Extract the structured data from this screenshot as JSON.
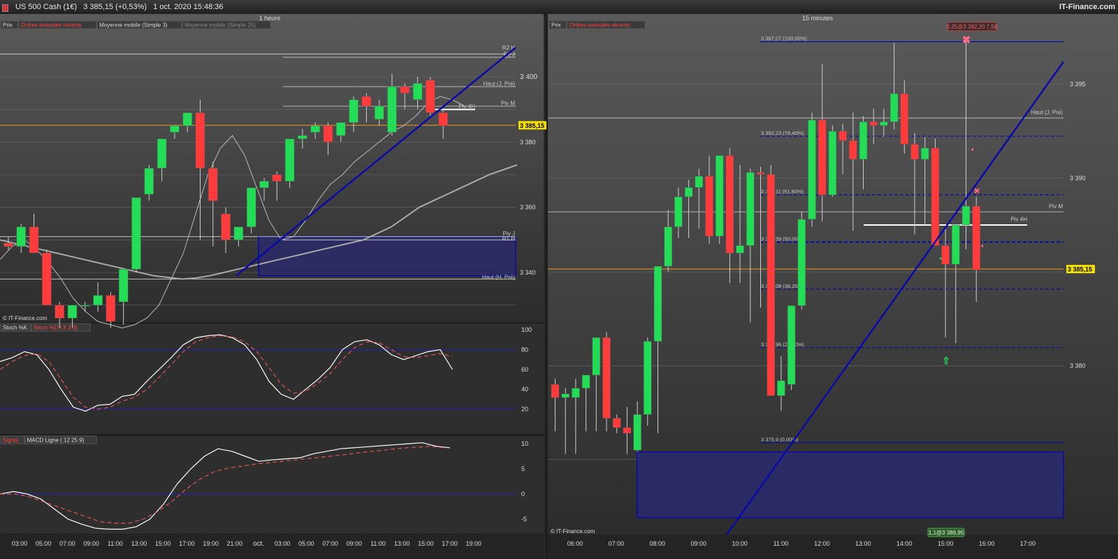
{
  "header": {
    "instrument": "US 500 Cash (1€)",
    "last_quote": "3 385,15 (+0,53%)",
    "datetime": "1 oct. 2020 15:48:36",
    "brand": "IT-Finance.com"
  },
  "colors": {
    "bull": "#22dd55",
    "bear": "#ff3b3b",
    "trend": "#0a0aa8",
    "last_price": "#e8a020",
    "zone": "#2a2a6a"
  },
  "left_chart": {
    "timeframe": "1 heure",
    "tabs": [
      "Prix",
      "Ordres exécutés récents",
      "Moyenne mobile (Simple 3)",
      "Moyenne mobile (Simple 25)"
    ],
    "price_ticks": [
      "3 400",
      "3 380",
      "3 360",
      "3 340"
    ],
    "last_price_label": "3 385,15",
    "levels": [
      "R2 H",
      "R1 J",
      "Haut (J, Pré)",
      "Piv M",
      "Piv 4H",
      "Piv J",
      "R1 H",
      "Haut (H, Pré)"
    ],
    "watermark": "© IT-Finance.com",
    "stoch": {
      "tabs": [
        "Stoch %K",
        "Stoch %D ( 8 3 3)"
      ],
      "ticks": [
        "100",
        "80",
        "60",
        "40",
        "20"
      ]
    },
    "macd": {
      "tabs": [
        "Signal",
        "MACD Ligne ( 12 25 9)"
      ],
      "ticks": [
        "10",
        "5",
        "0",
        "-5"
      ]
    },
    "time_labels": [
      "03:00",
      "05:00",
      "07:00",
      "09:00",
      "11:00",
      "13:00",
      "15:00",
      "17:00",
      "19:00",
      "21:00",
      "oct.",
      "03:00",
      "05:00",
      "07:00",
      "09:00",
      "11:00",
      "13:00",
      "15:00",
      "17:00",
      "19:00"
    ]
  },
  "right_chart": {
    "timeframe": "15 minutes",
    "tabs": [
      "Prix",
      "Ordres exécutés récents"
    ],
    "price_ticks": [
      "3 395",
      "3 390",
      "3 380"
    ],
    "last_price_label": "3 385,15",
    "order_top": "0,25@3 392,20 7,58",
    "order_bottom": "1,1@3 386,95",
    "fib_levels": [
      "3 397,27 (100,00%)",
      "3 392,23 (76,40%)",
      "3 389,11 (61,80%)",
      "3 386,59 (50,00%)",
      "3 384,08 (38,20%)",
      "3 380,96 (23,60%)",
      "3 375,9 (0,00%)"
    ],
    "levels": [
      "Haut (J, Pré)",
      "Piv M",
      "Piv 4H"
    ],
    "watermark": "© IT-Finance.com",
    "time_labels": [
      "06:00",
      "07:00",
      "08:00",
      "09:00",
      "10:00",
      "11:00",
      "12:00",
      "13:00",
      "14:00",
      "15:00",
      "16:00",
      "17:00"
    ]
  },
  "chart_data": [
    {
      "type": "candlestick",
      "title": "US 500 Cash (1€) — 1 heure",
      "ylim": [
        3325,
        3415
      ],
      "candles": [
        {
          "o": 3349,
          "h": 3351,
          "l": 3347,
          "c": 3348
        },
        {
          "o": 3348,
          "h": 3355,
          "l": 3346,
          "c": 3354
        },
        {
          "o": 3354,
          "h": 3358,
          "l": 3347,
          "c": 3346
        },
        {
          "o": 3346,
          "h": 3347,
          "l": 3330,
          "c": 3330
        },
        {
          "o": 3330,
          "h": 3331,
          "l": 3323,
          "c": 3326
        },
        {
          "o": 3326,
          "h": 3330,
          "l": 3323,
          "c": 3330
        },
        {
          "o": 3330,
          "h": 3331,
          "l": 3328,
          "c": 3330
        },
        {
          "o": 3330,
          "h": 3337,
          "l": 3328,
          "c": 3333
        },
        {
          "o": 3333,
          "h": 3334,
          "l": 3323,
          "c": 3325
        },
        {
          "o": 3331,
          "h": 3341,
          "l": 3324,
          "c": 3341
        },
        {
          "o": 3341,
          "h": 3363,
          "l": 3340,
          "c": 3363
        },
        {
          "o": 3364,
          "h": 3373,
          "l": 3362,
          "c": 3372
        },
        {
          "o": 3372,
          "h": 3380,
          "l": 3368,
          "c": 3381
        },
        {
          "o": 3383,
          "h": 3385,
          "l": 3381,
          "c": 3385
        },
        {
          "o": 3385,
          "h": 3389,
          "l": 3383,
          "c": 3389
        },
        {
          "o": 3389,
          "h": 3393,
          "l": 3350,
          "c": 3372
        },
        {
          "o": 3372,
          "h": 3374,
          "l": 3348,
          "c": 3362
        },
        {
          "o": 3358,
          "h": 3360,
          "l": 3346,
          "c": 3350
        },
        {
          "o": 3350,
          "h": 3352,
          "l": 3348,
          "c": 3354
        },
        {
          "o": 3354,
          "h": 3358,
          "l": 3352,
          "c": 3366
        },
        {
          "o": 3366,
          "h": 3369,
          "l": 3362,
          "c": 3368
        },
        {
          "o": 3370,
          "h": 3371,
          "l": 3362,
          "c": 3368
        },
        {
          "o": 3368,
          "h": 3381,
          "l": 3366,
          "c": 3381
        },
        {
          "o": 3381,
          "h": 3384,
          "l": 3378,
          "c": 3382
        },
        {
          "o": 3383,
          "h": 3386,
          "l": 3381,
          "c": 3385
        },
        {
          "o": 3385,
          "h": 3386,
          "l": 3376,
          "c": 3380
        },
        {
          "o": 3382,
          "h": 3386,
          "l": 3380,
          "c": 3386
        },
        {
          "o": 3386,
          "h": 3394,
          "l": 3383,
          "c": 3393
        },
        {
          "o": 3394,
          "h": 3395,
          "l": 3386,
          "c": 3391
        },
        {
          "o": 3387,
          "h": 3393,
          "l": 3385,
          "c": 3391
        },
        {
          "o": 3383,
          "h": 3401,
          "l": 3382,
          "c": 3397
        },
        {
          "o": 3397,
          "h": 3398,
          "l": 3390,
          "c": 3395
        },
        {
          "o": 3393,
          "h": 3400,
          "l": 3390,
          "c": 3398
        },
        {
          "o": 3399,
          "h": 3400,
          "l": 3388,
          "c": 3389
        },
        {
          "o": 3389,
          "h": 3390,
          "l": 3381,
          "c": 3385
        }
      ]
    },
    {
      "type": "candlestick",
      "title": "US 500 Cash (1€) — 15 minutes",
      "ylim": [
        3371,
        3398
      ],
      "candles": [
        {
          "o": 3379,
          "h": 3379.3,
          "l": 3376.5,
          "c": 3378.3
        },
        {
          "o": 3378.3,
          "h": 3378.8,
          "l": 3375.3,
          "c": 3378.5
        },
        {
          "o": 3378.3,
          "h": 3379.3,
          "l": 3375.3,
          "c": 3378.8
        },
        {
          "o": 3378.8,
          "h": 3379.5,
          "l": 3376.5,
          "c": 3379.5
        },
        {
          "o": 3379.5,
          "h": 3381.3,
          "l": 3376.5,
          "c": 3381.5
        },
        {
          "o": 3381.5,
          "h": 3381.8,
          "l": 3376.5,
          "c": 3377.2
        },
        {
          "o": 3377.2,
          "h": 3377.4,
          "l": 3376.4,
          "c": 3376.7
        },
        {
          "o": 3376.7,
          "h": 3377.8,
          "l": 3375.3,
          "c": 3376.4
        },
        {
          "o": 3375.5,
          "h": 3378.1,
          "l": 3374.3,
          "c": 3377.4
        },
        {
          "o": 3377.4,
          "h": 3381.5,
          "l": 3376.8,
          "c": 3381.3
        },
        {
          "o": 3381.3,
          "h": 3385.2,
          "l": 3376.4,
          "c": 3385.3
        },
        {
          "o": 3385.3,
          "h": 3388.3,
          "l": 3385.0,
          "c": 3387.4
        },
        {
          "o": 3387.4,
          "h": 3389.5,
          "l": 3386.8,
          "c": 3389.0
        },
        {
          "o": 3389.0,
          "h": 3389.9,
          "l": 3386.8,
          "c": 3389.5
        },
        {
          "o": 3389.5,
          "h": 3390.5,
          "l": 3387.3,
          "c": 3390.1
        },
        {
          "o": 3390.1,
          "h": 3391.2,
          "l": 3386.5,
          "c": 3386.9
        },
        {
          "o": 3386.9,
          "h": 3391.2,
          "l": 3386.5,
          "c": 3391.2
        },
        {
          "o": 3391.2,
          "h": 3391.6,
          "l": 3384.4,
          "c": 3386.0
        },
        {
          "o": 3386.0,
          "h": 3390.7,
          "l": 3384.4,
          "c": 3386.4
        },
        {
          "o": 3386.4,
          "h": 3390.5,
          "l": 3382.3,
          "c": 3390.3
        },
        {
          "o": 3390.3,
          "h": 3390.6,
          "l": 3383.1,
          "c": 3390.2
        },
        {
          "o": 3390.2,
          "h": 3390.7,
          "l": 3380.9,
          "c": 3378.4
        },
        {
          "o": 3378.4,
          "h": 3380.5,
          "l": 3377.6,
          "c": 3379.2
        },
        {
          "o": 3379.0,
          "h": 3383.2,
          "l": 3378.7,
          "c": 3383.2
        },
        {
          "o": 3383.2,
          "h": 3388.2,
          "l": 3383.0,
          "c": 3387.8
        },
        {
          "o": 3387.8,
          "h": 3393.5,
          "l": 3387.4,
          "c": 3393.1
        },
        {
          "o": 3393.1,
          "h": 3396.1,
          "l": 3387.7,
          "c": 3389.1
        },
        {
          "o": 3389.1,
          "h": 3392.8,
          "l": 3389.0,
          "c": 3392.5
        },
        {
          "o": 3392.5,
          "h": 3392.9,
          "l": 3390.2,
          "c": 3392.0
        },
        {
          "o": 3392.0,
          "h": 3393.5,
          "l": 3387.2,
          "c": 3391.0
        },
        {
          "o": 3391.0,
          "h": 3393.3,
          "l": 3389.4,
          "c": 3393.0
        },
        {
          "o": 3393.0,
          "h": 3393.7,
          "l": 3391.8,
          "c": 3392.8
        },
        {
          "o": 3392.8,
          "h": 3393.7,
          "l": 3392.2,
          "c": 3393.0
        },
        {
          "o": 3393.0,
          "h": 3397.2,
          "l": 3392.6,
          "c": 3394.5
        },
        {
          "o": 3394.5,
          "h": 3395.2,
          "l": 3391.3,
          "c": 3391.8
        },
        {
          "o": 3391.8,
          "h": 3392.4,
          "l": 3387.0,
          "c": 3391.0
        },
        {
          "o": 3391.0,
          "h": 3392.2,
          "l": 3387.5,
          "c": 3391.6
        },
        {
          "o": 3391.6,
          "h": 3392.1,
          "l": 3386.4,
          "c": 3386.4
        },
        {
          "o": 3386.4,
          "h": 3387.3,
          "l": 3381.5,
          "c": 3385.4
        },
        {
          "o": 3385.4,
          "h": 3387.3,
          "l": 3381.2,
          "c": 3387.5
        },
        {
          "o": 3387.5,
          "h": 3397.3,
          "l": 3386.2,
          "c": 3388.5
        },
        {
          "o": 3388.5,
          "h": 3389.0,
          "l": 3383.4,
          "c": 3385.1
        }
      ]
    }
  ]
}
